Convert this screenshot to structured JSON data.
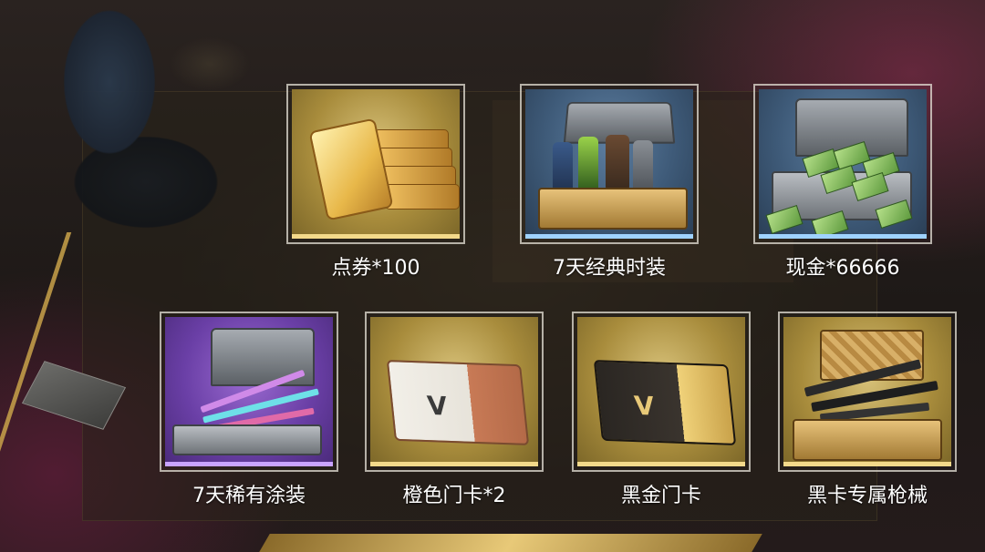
{
  "colors": {
    "gold_accent": "#c9a24a",
    "gold_bar": "#f3d98a",
    "blue_bar": "#9fd2ff",
    "purple_bar": "#c9a3ff",
    "label": "#ffffff"
  },
  "rewards_top": [
    {
      "label": "点券*100",
      "rarity": "gold",
      "icon": "gold-voucher-icon"
    },
    {
      "label": "7天经典时装",
      "rarity": "blue",
      "icon": "outfit-chest-icon"
    },
    {
      "label": "现金*66666",
      "rarity": "blue",
      "icon": "cash-case-icon"
    }
  ],
  "rewards_bottom": [
    {
      "label": "7天稀有涂装",
      "rarity": "purple",
      "icon": "weapon-skin-case-icon"
    },
    {
      "label": "橙色门卡*2",
      "rarity": "gold",
      "icon": "orange-keycard-icon"
    },
    {
      "label": "黑金门卡",
      "rarity": "gold",
      "icon": "black-gold-keycard-icon"
    },
    {
      "label": "黑卡专属枪械",
      "rarity": "gold",
      "icon": "gun-case-icon"
    }
  ]
}
